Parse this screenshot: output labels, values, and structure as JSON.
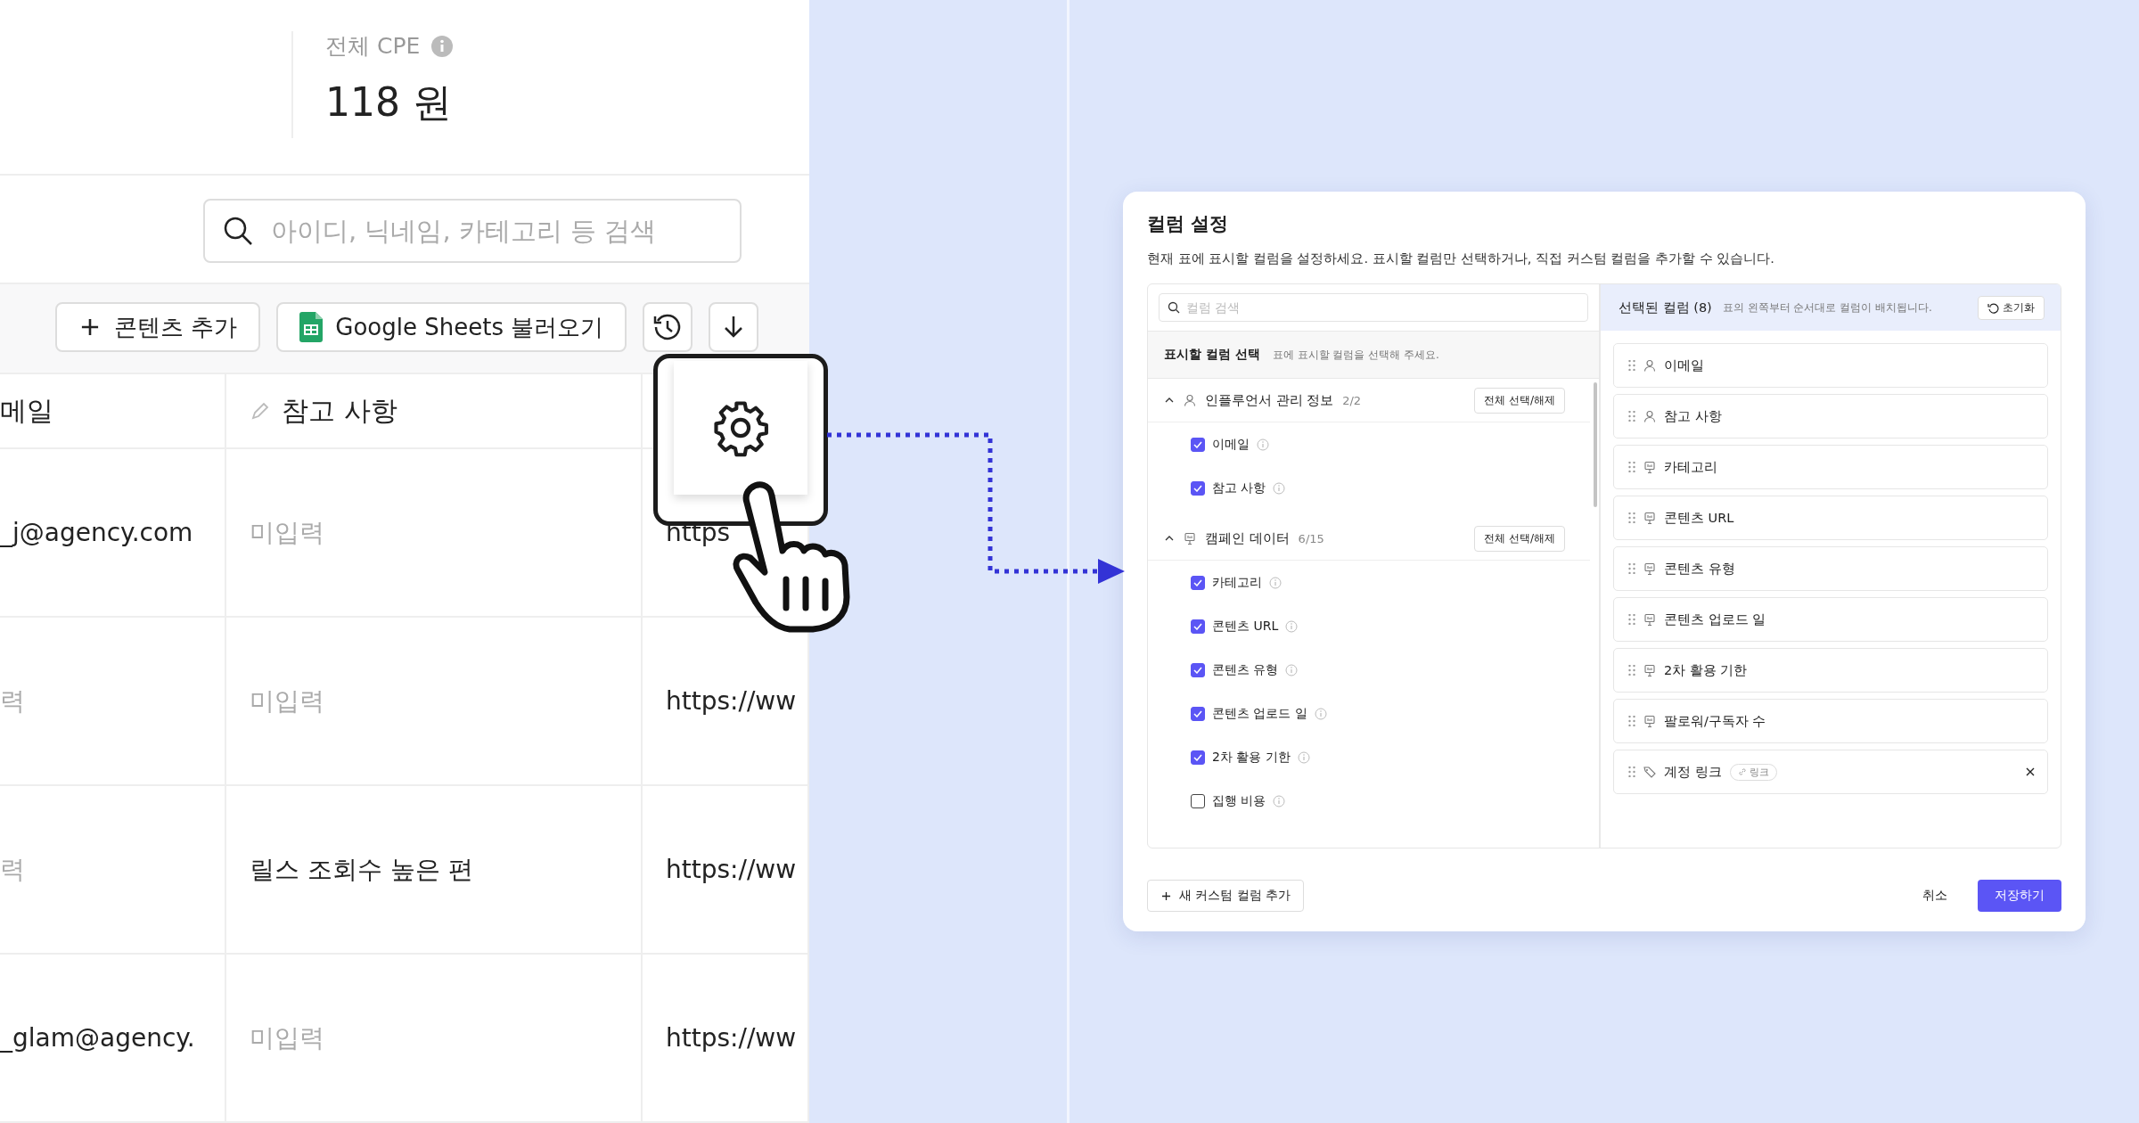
{
  "stats": {
    "label": "전체 CPE",
    "value": "118 원"
  },
  "search": {
    "placeholder": "아이디, 닉네임, 카테고리 등 검색"
  },
  "toolbar": [
    {
      "kind": "add",
      "label": "콘텐츠 추가"
    },
    {
      "kind": "sheets",
      "label": "Google Sheets 불러오기"
    },
    {
      "kind": "history"
    },
    {
      "kind": "download"
    }
  ],
  "table": {
    "columns": [
      {
        "label": "메일",
        "kind": "plain"
      },
      {
        "label": "참고 사항",
        "kind": "editable"
      }
    ],
    "rows": [
      {
        "cells": [
          {
            "text": "_j@agency.com",
            "empty": false
          },
          {
            "text": "미입력",
            "empty": true
          },
          {
            "text": "https",
            "empty": false
          }
        ]
      },
      {
        "cells": [
          {
            "text": "력",
            "empty": true
          },
          {
            "text": "미입력",
            "empty": true
          },
          {
            "text": "https://ww",
            "empty": false
          }
        ]
      },
      {
        "cells": [
          {
            "text": "력",
            "empty": true
          },
          {
            "text": "릴스 조회수 높은 편",
            "empty": false
          },
          {
            "text": "https://ww",
            "empty": false
          }
        ]
      },
      {
        "cells": [
          {
            "text": "_glam@agency.",
            "empty": false
          },
          {
            "text": "미입력",
            "empty": true
          },
          {
            "text": "https://ww",
            "empty": false
          }
        ]
      }
    ]
  },
  "modal": {
    "title": "컬럼 설정",
    "description": "현재 표에 표시할 컬럼을 설정하세요. 표시할 컬럼만 선택하거나, 직접 커스텀 컬럼을 추가할 수 있습니다.",
    "search_placeholder": "컬럼 검색",
    "section_title": "표시할 컬럼 선택",
    "section_hint": "표에 표시할 컬럼을 선택해 주세요.",
    "groups": [
      {
        "kind": "person",
        "name": "인플루언서 관리 정보",
        "count": "2/2",
        "expanded": true,
        "toggle": "전체 선택/해제",
        "items": [
          {
            "label": "이메일",
            "checked": true
          },
          {
            "label": "참고 사항",
            "checked": true
          }
        ]
      },
      {
        "kind": "campaign",
        "name": "캠페인 데이터",
        "count": "6/15",
        "expanded": true,
        "toggle": "전체 선택/해제",
        "items": [
          {
            "label": "카테고리",
            "checked": true
          },
          {
            "label": "콘텐츠 URL",
            "checked": true
          },
          {
            "label": "콘텐츠 유형",
            "checked": true
          },
          {
            "label": "콘텐츠 업로드 일",
            "checked": true
          },
          {
            "label": "2차 활용 기한",
            "checked": true
          },
          {
            "label": "집행 비용",
            "checked": false
          }
        ]
      }
    ],
    "selected": {
      "title": "선택된 컬럼 (8)",
      "hint": "표의 왼쪽부터 순서대로 컬럼이 배치됩니다.",
      "reset": "초기화",
      "items": [
        {
          "kind": "person",
          "label": "이메일",
          "removable": false
        },
        {
          "kind": "person",
          "label": "참고 사항",
          "removable": false
        },
        {
          "kind": "campaign",
          "label": "카테고리",
          "removable": false
        },
        {
          "kind": "campaign",
          "label": "콘텐츠 URL",
          "removable": false
        },
        {
          "kind": "campaign",
          "label": "콘텐츠 유형",
          "removable": false
        },
        {
          "kind": "campaign",
          "label": "콘텐츠 업로드 일",
          "removable": false
        },
        {
          "kind": "campaign",
          "label": "2차 활용 기한",
          "removable": false
        },
        {
          "kind": "campaign",
          "label": "팔로워/구독자 수",
          "removable": false
        },
        {
          "kind": "link",
          "label": "계정 링크",
          "tag": "링크",
          "removable": true
        }
      ]
    },
    "add_button": "새 커스텀 컬럼 추가",
    "cancel": "취소",
    "save": "저장하기"
  }
}
